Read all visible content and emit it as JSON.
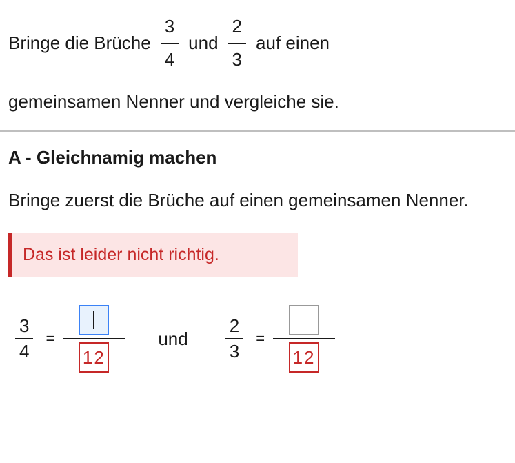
{
  "question": {
    "prefix": "Bringe die Brüche",
    "fraction1": {
      "num": "3",
      "den": "4"
    },
    "mid": "und",
    "fraction2": {
      "num": "2",
      "den": "3"
    },
    "suffix": "auf einen",
    "line2": "gemeinsamen Nenner und vergleiche sie."
  },
  "sectionA": {
    "heading": "A - Gleichnamig machen",
    "instruction": "Bringe zuerst die Brüche auf einen gemeinsamen Nenner.",
    "feedback": "Das ist leider nicht richtig."
  },
  "equations": {
    "left": {
      "given": {
        "num": "3",
        "den": "4"
      },
      "equals": "=",
      "input": {
        "num": "",
        "den": "12"
      }
    },
    "connector": "und",
    "right": {
      "given": {
        "num": "2",
        "den": "3"
      },
      "equals": "=",
      "input": {
        "num": "",
        "den": "12"
      }
    }
  }
}
